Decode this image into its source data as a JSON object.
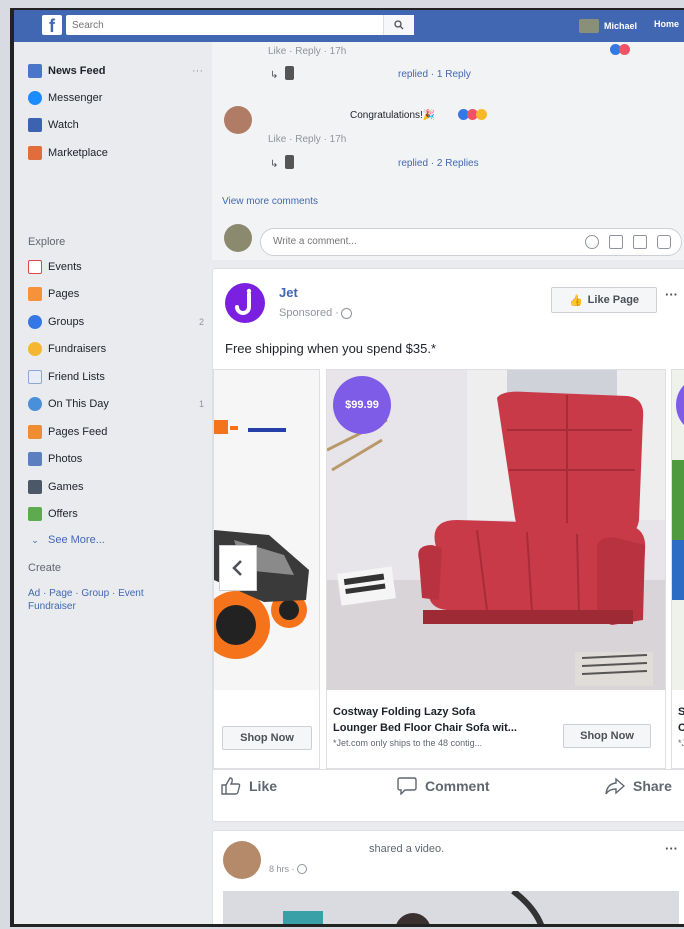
{
  "topbar": {
    "search_placeholder": "Search",
    "profile_name": "Michael",
    "home_label": "Home"
  },
  "sidebar": {
    "items": [
      {
        "label": "News Feed",
        "icon": "news-feed-icon",
        "more": "···"
      },
      {
        "label": "Messenger",
        "icon": "messenger-icon"
      },
      {
        "label": "Watch",
        "icon": "watch-icon"
      },
      {
        "label": "Marketplace",
        "icon": "marketplace-icon"
      }
    ],
    "explore_label": "Explore",
    "explore_items": [
      {
        "label": "Events",
        "icon": "events-icon",
        "count": ""
      },
      {
        "label": "Pages",
        "icon": "pages-icon",
        "count": ""
      },
      {
        "label": "Groups",
        "icon": "groups-icon",
        "count": "2"
      },
      {
        "label": "Fundraisers",
        "icon": "fundraisers-icon",
        "count": ""
      },
      {
        "label": "Friend Lists",
        "icon": "friend-lists-icon",
        "count": ""
      },
      {
        "label": "On This Day",
        "icon": "on-this-day-icon",
        "count": "1"
      },
      {
        "label": "Pages Feed",
        "icon": "pages-feed-icon",
        "count": ""
      },
      {
        "label": "Photos",
        "icon": "photos-icon",
        "count": ""
      },
      {
        "label": "Games",
        "icon": "games-icon",
        "count": ""
      },
      {
        "label": "Offers",
        "icon": "offers-icon",
        "count": ""
      },
      {
        "label": "See More...",
        "icon": "chevron-down-icon",
        "count": ""
      }
    ],
    "create_label": "Create",
    "create_links": [
      "Ad",
      "Page",
      "Group",
      "Event",
      "Fundraiser"
    ]
  },
  "comments": {
    "thread1_meta": "Like · Reply · 17h",
    "thread1_replied": "replied · 1 Reply",
    "comment2_text": "Congratulations!🎉",
    "thread2_meta": "Like · Reply · 17h",
    "thread2_replied": "replied · 2 Replies",
    "view_more": "View more comments",
    "write_placeholder": "Write a comment..."
  },
  "ad_post": {
    "page_name": "Jet",
    "sponsored": "Sponsored · ",
    "like_page": "Like Page",
    "more": "···",
    "text": "Free shipping when you spend $35.*",
    "products": [
      {
        "shop_label": "Shop Now"
      },
      {
        "price": "$99.99",
        "title": "Costway Folding Lazy Sofa",
        "subtitle": "Lounger Bed Floor Chair Sofa wit...",
        "note": "*Jet.com only ships to the 48 contig...",
        "shop_label": "Shop Now"
      },
      {
        "price_partial": "$",
        "title_partial": "Sp",
        "subtitle_partial": "Co",
        "note_partial": "*J"
      }
    ],
    "actions": {
      "like": "Like",
      "comment": "Comment",
      "share": "Share"
    }
  },
  "next_post": {
    "action_text": "shared a video.",
    "time": "8 hrs · ",
    "more": "···"
  },
  "colors": {
    "brand": "#4267b2",
    "jet_purple": "#7b1fe0",
    "price_badge": "#7f5ce8",
    "sofa_red": "#c93a48"
  }
}
